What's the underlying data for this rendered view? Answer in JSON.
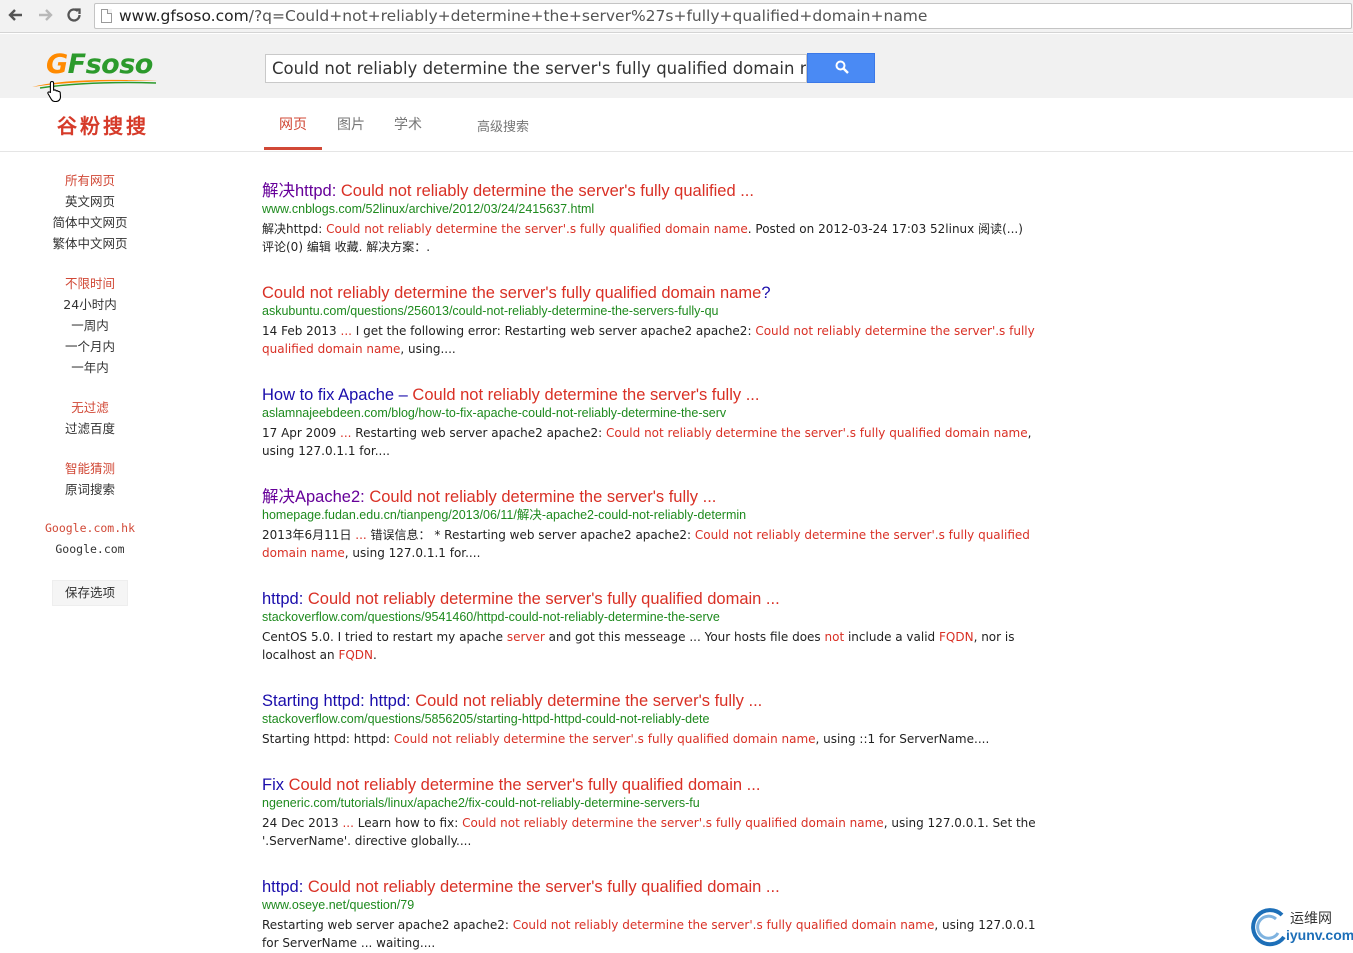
{
  "browser": {
    "url_host": "www.gfsoso.com",
    "url_rest": "/?q=Could+not+reliably+determine+the+server%27s+fully+qualified+domain+name"
  },
  "header": {
    "logo_text_g": "G",
    "logo_text_rest": "Fsoso",
    "search_value": "Could not reliably determine the server's fully qualified domain name",
    "cn_logo": "谷粉搜搜"
  },
  "tabs": {
    "web": "网页",
    "images": "图片",
    "scholar": "学术",
    "advanced": "高级搜索"
  },
  "sidebar": {
    "all_pages": "所有网页",
    "english_pages": "英文网页",
    "simplified_pages": "简体中文网页",
    "traditional_pages": "繁体中文网页",
    "any_time": "不限时间",
    "past_24h": "24小时内",
    "past_week": "一周内",
    "past_month": "一个月内",
    "past_year": "一年内",
    "no_filter": "无过滤",
    "filter_baidu": "过滤百度",
    "smart_guess": "智能猜测",
    "exact_search": "原词搜索",
    "google_hk": "Google.com.hk",
    "google_com": "Google.com",
    "save_options": "保存选项"
  },
  "results": [
    {
      "title_prefix": "解决httpd: ",
      "title_hl": "Could not reliably determine the server's fully qualified ...",
      "title_suffix": "",
      "url": "www.cnblogs.com/52linux/archive/2012/03/24/2415637.html",
      "snip_a": "解决httpd: ",
      "snip_hl": "Could not reliably determine the server'.s fully qualified domain name",
      "snip_b": ". Posted on 2012-03-24 17:03 52linux 阅读(...) 评论(0) 编辑 收藏. 解决方案：."
    },
    {
      "title_prefix": "",
      "title_hl": "Could not reliably determine the server's fully qualified domain name",
      "title_suffix": "?",
      "url": "askubuntu.com/questions/256013/could-not-reliably-determine-the-servers-fully-qu",
      "snip_a": "14 Feb 2013 ",
      "snip_dots": "...",
      "snip_b": " I get the following error: Restarting web server apache2 apache2: ",
      "snip_hl": "Could not reliably determine the server'.s fully qualified domain name",
      "snip_c": ", using...."
    },
    {
      "title_prefix": "How to fix Apache – ",
      "title_hl": "Could not reliably determine the server's fully ...",
      "title_suffix": "",
      "url": "aslamnajeebdeen.com/blog/how-to-fix-apache-could-not-reliably-determine-the-serv",
      "snip_a": "17 Apr 2009 ",
      "snip_dots": "...",
      "snip_b": " Restarting web server apache2 apache2: ",
      "snip_hl": "Could not reliably determine the server'.s fully qualified domain name",
      "snip_c": ", using 127.0.1.1 for...."
    },
    {
      "title_prefix": "解决Apache2: ",
      "title_hl": "Could not reliably determine the server's fully ...",
      "title_suffix": "",
      "url": "homepage.fudan.edu.cn/tianpeng/2013/06/11/解决-apache2-could-not-reliably-determin",
      "snip_a": "2013年6月11日 ",
      "snip_dots": "...",
      "snip_b": " 错误信息：  * Restarting web server apache2 apache2: ",
      "snip_hl": "Could not reliably determine the server'.s fully qualified domain name",
      "snip_c": ", using 127.0.1.1 for...."
    },
    {
      "title_prefix": "httpd: ",
      "title_hl": "Could not reliably determine the server's fully qualified domain ...",
      "title_suffix": "",
      "url": "stackoverflow.com/questions/9541460/httpd-could-not-reliably-determine-the-serve",
      "snip_a": "CentOS 5.0. I tried to restart my apache ",
      "snip_hl1": "server",
      "snip_b": " and got this messeage ... Your hosts file does ",
      "snip_hl2": "not",
      "snip_c": " include a valid ",
      "snip_hl3": "FQDN",
      "snip_d": ", nor is localhost an ",
      "snip_hl4": "FQDN",
      "snip_e": "."
    },
    {
      "title_prefix": "Starting httpd: httpd: ",
      "title_hl": "Could not reliably determine the server's fully ...",
      "title_suffix": "",
      "url": "stackoverflow.com/questions/5856205/starting-httpd-httpd-could-not-reliably-dete",
      "snip_a": "Starting httpd: httpd: ",
      "snip_hl": "Could not reliably determine the server'.s fully qualified domain name",
      "snip_b": ", using ::1 for ServerName...."
    },
    {
      "title_prefix": "Fix ",
      "title_hl": "Could not reliably determine the server's fully qualified domain ...",
      "title_suffix": "",
      "url": "ngeneric.com/tutorials/linux/apache2/fix-could-not-reliably-determine-servers-fu",
      "snip_a": "24 Dec 2013 ",
      "snip_dots": "...",
      "snip_b": " Learn how to fix: ",
      "snip_hl": "Could not reliably determine the server'.s fully qualified domain name",
      "snip_c": ", using 127.0.0.1. Set the '.ServerName'. directive globally...."
    },
    {
      "title_prefix": "httpd: ",
      "title_hl": "Could not reliably determine the server's fully qualified domain ...",
      "title_suffix": "",
      "url": "www.oseye.net/question/79",
      "snip_a": "Restarting web server apache2 apache2: ",
      "snip_hl": "Could not reliably determine the server'.s fully qualified domain name",
      "snip_b": ", using 127.0.0.1 for ServerName ... waiting...."
    }
  ],
  "watermark": {
    "top": "运维网",
    "bottom": "iyunv.com"
  },
  "colors": {
    "accent_red": "#d93025",
    "link_blue": "#1a0dab",
    "url_green": "#1e8a1e",
    "search_button": "#4a8af4"
  }
}
